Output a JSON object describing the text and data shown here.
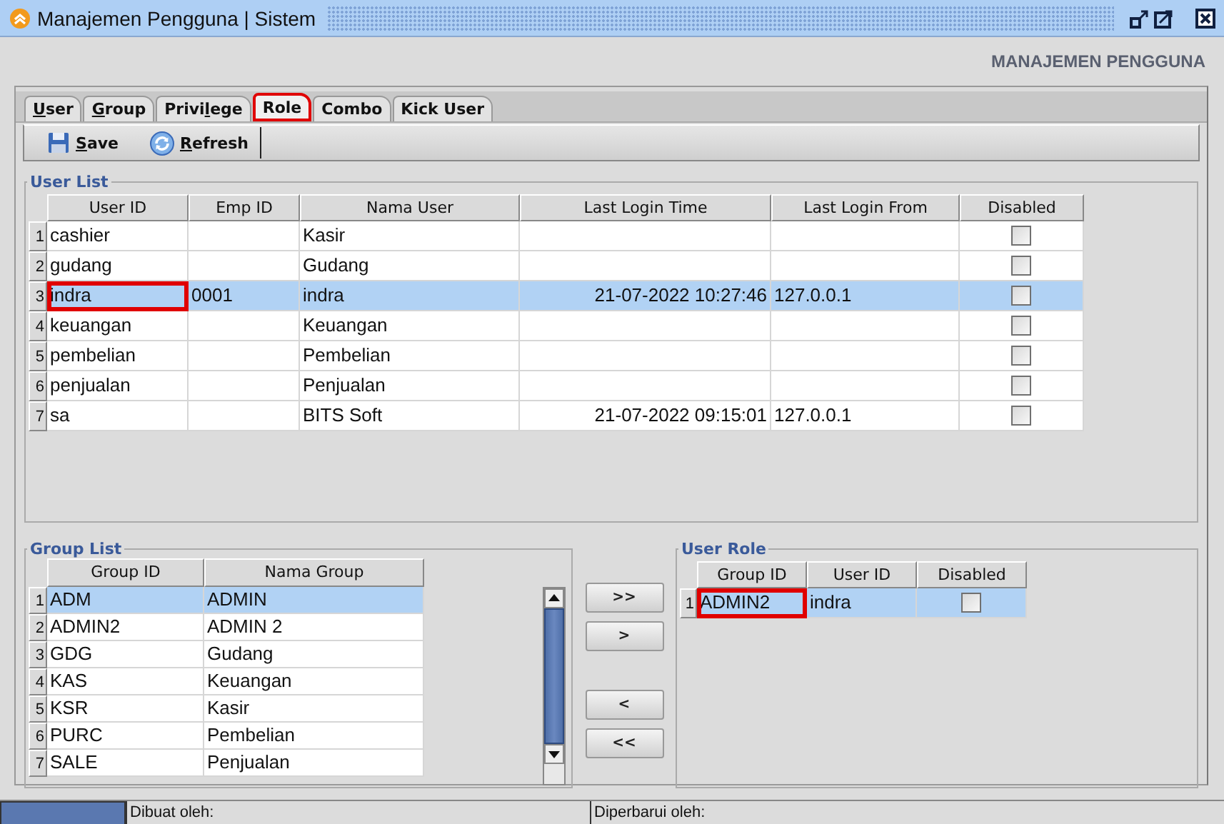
{
  "window": {
    "title": "Manajemen Pengguna | Sistem"
  },
  "heading": "MANAJEMEN PENGGUNA",
  "tabs": [
    {
      "key": "U",
      "post": "ser",
      "selected": false,
      "annotated": false
    },
    {
      "key": "G",
      "post": "roup",
      "selected": false,
      "annotated": false
    },
    {
      "pre": "Privi",
      "key": "l",
      "post": "ege",
      "selected": false,
      "annotated": false
    },
    {
      "post": "Role",
      "selected": true,
      "annotated": true
    },
    {
      "post": "Combo",
      "selected": false,
      "annotated": false
    },
    {
      "post": "Kick User",
      "selected": false,
      "annotated": false
    }
  ],
  "toolbar": [
    {
      "kind": "save",
      "key": "S",
      "post": "ave"
    },
    {
      "kind": "refresh",
      "key": "R",
      "post": "efresh"
    }
  ],
  "user_list": {
    "title": "User List",
    "columns": [
      {
        "label": "User ID",
        "kind": "text"
      },
      {
        "label": "Emp ID",
        "kind": "text"
      },
      {
        "label": "Nama User",
        "kind": "text"
      },
      {
        "label": "Last Login Time",
        "kind": "datetime"
      },
      {
        "label": "Last Login From",
        "kind": "text"
      },
      {
        "label": "Disabled",
        "kind": "check"
      }
    ],
    "rows": [
      {
        "no": "1",
        "cells": [
          {
            "text": "cashier"
          },
          {},
          {
            "text": "Kasir"
          },
          {},
          {},
          {
            "checked": false
          }
        ],
        "selected": false
      },
      {
        "no": "2",
        "cells": [
          {
            "text": "gudang"
          },
          {},
          {
            "text": "Gudang"
          },
          {},
          {},
          {
            "checked": false
          }
        ],
        "selected": false
      },
      {
        "no": "3",
        "cells": [
          {
            "text": "indra",
            "annotated": true
          },
          {
            "text": "0001"
          },
          {
            "text": "indra"
          },
          {
            "text": "21-07-2022 10:27:46"
          },
          {
            "text": "127.0.0.1"
          },
          {
            "checked": false
          }
        ],
        "selected": true
      },
      {
        "no": "4",
        "cells": [
          {
            "text": "keuangan"
          },
          {},
          {
            "text": "Keuangan"
          },
          {},
          {},
          {
            "checked": false
          }
        ],
        "selected": false
      },
      {
        "no": "5",
        "cells": [
          {
            "text": "pembelian"
          },
          {},
          {
            "text": "Pembelian"
          },
          {},
          {},
          {
            "checked": false
          }
        ],
        "selected": false
      },
      {
        "no": "6",
        "cells": [
          {
            "text": "penjualan"
          },
          {},
          {
            "text": "Penjualan"
          },
          {},
          {},
          {
            "checked": false
          }
        ],
        "selected": false
      },
      {
        "no": "7",
        "cells": [
          {
            "text": "sa"
          },
          {},
          {
            "text": "BITS Soft"
          },
          {
            "text": "21-07-2022 09:15:01"
          },
          {
            "text": "127.0.0.1"
          },
          {
            "checked": false
          }
        ],
        "selected": false
      }
    ]
  },
  "group_list": {
    "title": "Group List",
    "columns": [
      {
        "label": "Group ID",
        "kind": "text"
      },
      {
        "label": "Nama Group",
        "kind": "text"
      }
    ],
    "rows": [
      {
        "no": "1",
        "cells": [
          {
            "text": "ADM"
          },
          {
            "text": "ADMIN"
          }
        ],
        "selected": true
      },
      {
        "no": "2",
        "cells": [
          {
            "text": "ADMIN2"
          },
          {
            "text": "ADMIN 2"
          }
        ],
        "selected": false
      },
      {
        "no": "3",
        "cells": [
          {
            "text": "GDG"
          },
          {
            "text": "Gudang"
          }
        ],
        "selected": false
      },
      {
        "no": "4",
        "cells": [
          {
            "text": "KAS"
          },
          {
            "text": "Keuangan"
          }
        ],
        "selected": false
      },
      {
        "no": "5",
        "cells": [
          {
            "text": "KSR"
          },
          {
            "text": "Kasir"
          }
        ],
        "selected": false
      },
      {
        "no": "6",
        "cells": [
          {
            "text": "PURC"
          },
          {
            "text": "Pembelian"
          }
        ],
        "selected": false
      },
      {
        "no": "7",
        "cells": [
          {
            "text": "SALE"
          },
          {
            "text": "Penjualan"
          }
        ],
        "selected": false
      }
    ]
  },
  "move_buttons": [
    ">>",
    ">",
    "<",
    "<<"
  ],
  "user_role": {
    "title": "User Role",
    "columns": [
      {
        "label": "Group ID",
        "kind": "text"
      },
      {
        "label": "User ID",
        "kind": "text"
      },
      {
        "label": "Disabled",
        "kind": "check"
      }
    ],
    "rows": [
      {
        "no": "1",
        "cells": [
          {
            "text": "ADMIN2",
            "annotated": true
          },
          {
            "text": "indra"
          },
          {
            "checked": false
          }
        ],
        "selected": true
      }
    ]
  },
  "status_bar": {
    "created_by": "Dibuat oleh:",
    "updated_by": "Diperbarui oleh:"
  }
}
